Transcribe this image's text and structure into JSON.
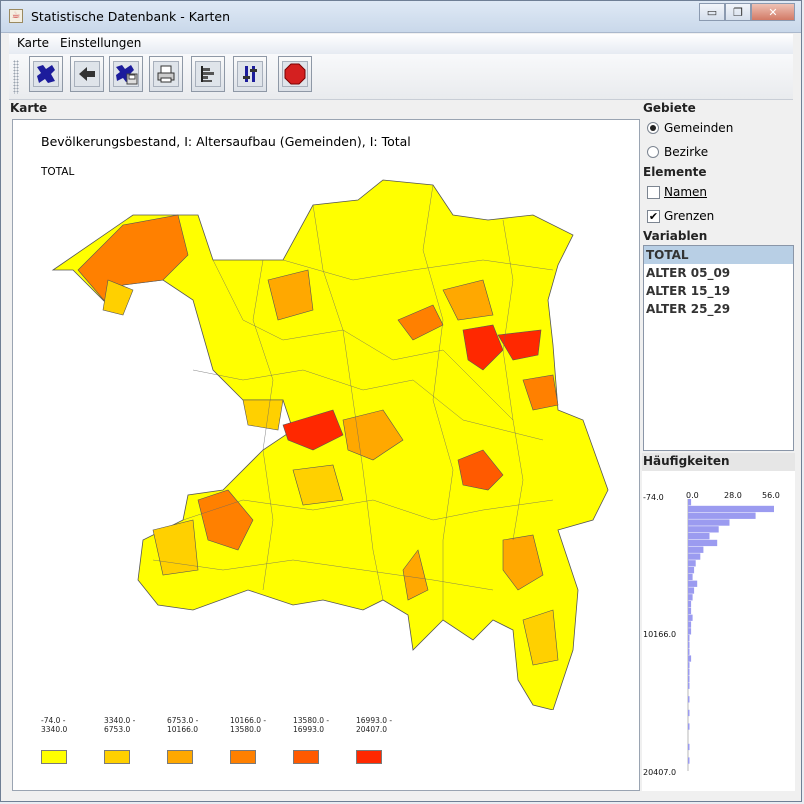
{
  "window": {
    "title": "Statistische Datenbank - Karten",
    "minimize_label": "▭",
    "maximize_label": "❐",
    "close_label": "✕"
  },
  "menu": [
    "Karte",
    "Einstellungen"
  ],
  "toolbar": {
    "buttons": [
      {
        "name": "map-view-icon"
      },
      {
        "name": "back-arrow-icon"
      },
      {
        "name": "save-map-icon"
      },
      {
        "name": "print-icon"
      },
      {
        "name": "histogram-icon"
      },
      {
        "name": "settings-tools-icon"
      },
      {
        "name": "stop-icon"
      }
    ]
  },
  "map_section": {
    "label": "Karte",
    "title": "Bevölkerungsbestand, I:  Altersaufbau (Gemeinden), I: Total",
    "subtitle": "TOTAL",
    "legend": [
      {
        "range": "-74.0 -\n3340.0",
        "color": "#ffff00"
      },
      {
        "range": "3340.0 -\n6753.0",
        "color": "#ffd000"
      },
      {
        "range": "6753.0 -\n10166.0",
        "color": "#ffa800"
      },
      {
        "range": "10166.0 -\n13580.0",
        "color": "#ff8000"
      },
      {
        "range": "13580.0 -\n16993.0",
        "color": "#ff5a00"
      },
      {
        "range": "16993.0 -\n20407.0",
        "color": "#ff2800"
      }
    ]
  },
  "gebiete": {
    "label": "Gebiete",
    "options": [
      "Gemeinden",
      "Bezirke"
    ],
    "selected": "Gemeinden"
  },
  "elemente": {
    "label": "Elemente",
    "items": [
      {
        "label": "Namen",
        "checked": false
      },
      {
        "label": "Grenzen",
        "checked": true
      }
    ]
  },
  "variablen": {
    "label": "Variablen",
    "items": [
      "TOTAL",
      "ALTER 05_09",
      "ALTER 15_19",
      "ALTER 25_29"
    ],
    "selected": "TOTAL"
  },
  "haeufigkeiten": {
    "label": "Häufigkeiten",
    "axis_x": [
      "0.0",
      "28.0",
      "56.0"
    ],
    "axis_y": [
      "-74.0",
      "10166.0",
      "20407.0"
    ],
    "bar_color": "#9b9bf0",
    "bars": [
      2,
      56,
      44,
      27,
      20,
      14,
      19,
      10,
      8,
      5,
      4,
      3,
      6,
      4,
      3,
      2,
      2,
      3,
      2,
      2,
      1,
      1,
      1,
      2,
      1,
      1,
      1,
      1,
      0,
      1,
      0,
      1,
      0,
      1,
      0,
      0,
      1,
      0,
      1,
      0
    ]
  }
}
